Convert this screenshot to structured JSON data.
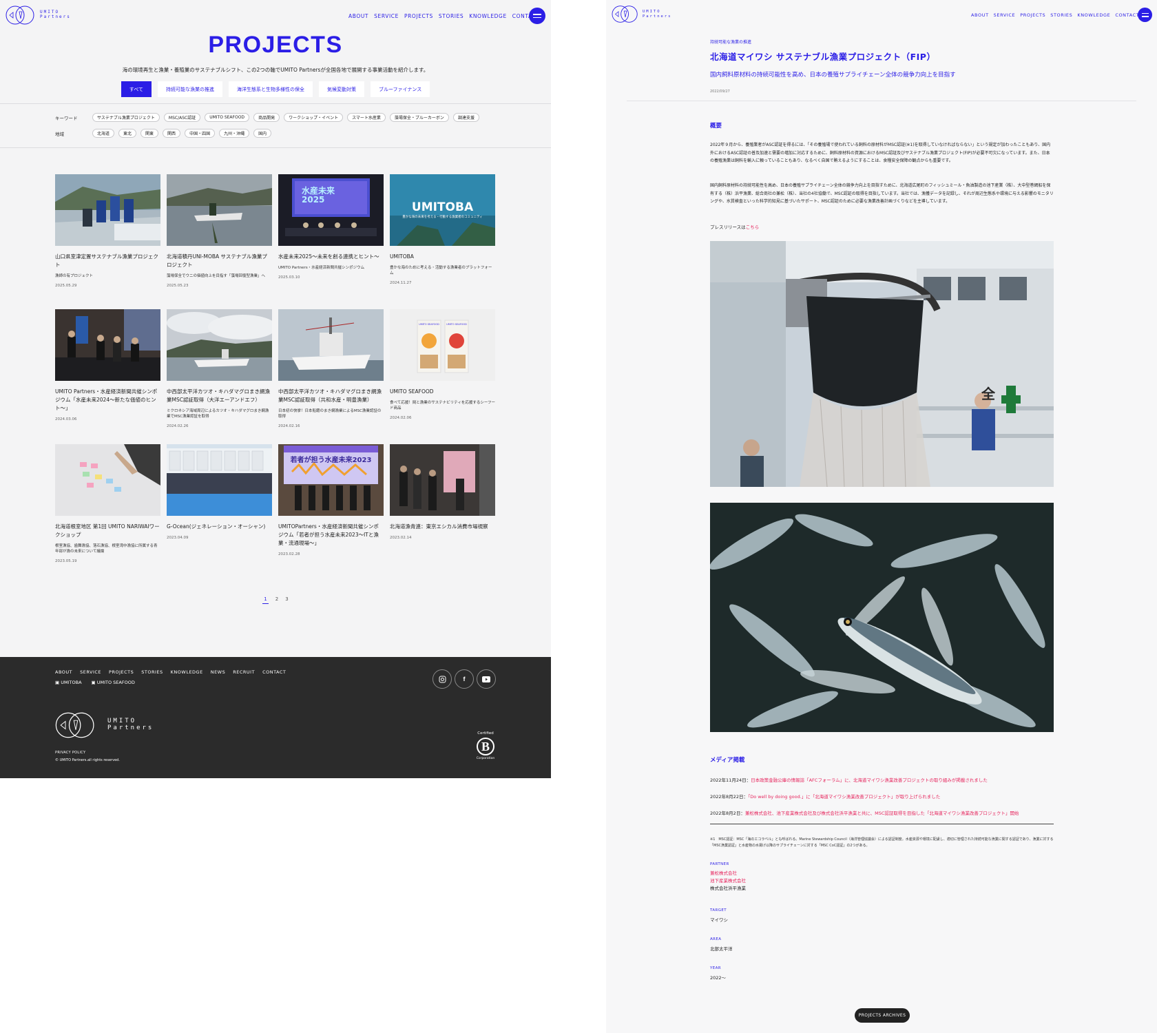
{
  "brand": {
    "name_line1": "UMITO",
    "name_line2": "Partners",
    "accent": "#2b1ee6",
    "link_color": "#e6245c"
  },
  "nav": {
    "items": [
      "ABOUT",
      "SERVICE",
      "PROJECTS",
      "STORIES",
      "KNOWLEDGE",
      "CONTACT"
    ],
    "menu_icon": "hamburger-icon"
  },
  "listing": {
    "title": "PROJECTS",
    "lead": "海の環境再生と漁業・養殖業のサステナブルシフト、この2つの軸でUMITO Partnersが全国各地で展開する事業活動を紹介します。",
    "tabs": [
      "すべて",
      "持続可能な漁業の推進",
      "海洋生態系と生物多様性の保全",
      "気候変動対策",
      "ブルーファイナンス"
    ],
    "filters": {
      "keyword_label": "キーワード",
      "keywords": [
        "サステナブル漁業プロジェクト",
        "MSC/ASC認証",
        "UMITO SEAFOOD",
        "商品開発",
        "ワークショップ・イベント",
        "スマート水産業",
        "藻場保全・ブルーカーボン",
        "調達支援"
      ],
      "region_label": "地域",
      "regions": [
        "北海道",
        "東北",
        "関東",
        "関西",
        "中国・四国",
        "九州・沖縄",
        "国内"
      ]
    },
    "cards": [
      {
        "title": "山口県室津定置サステナブル漁業プロジェクト",
        "sub": "漁師の有プロジェクト",
        "date": "2025.05.29"
      },
      {
        "title": "北海道積丹UNI-MOBA サステナブル漁業プロジェクト",
        "sub": "藻場保全でウニの価値向上を目指す「藻場回復型漁業」へ",
        "date": "2025.05.23"
      },
      {
        "title": "水産未来2025〜未来を創る連携とヒント〜",
        "sub": "UMITO Partners・水産経済新聞共催シンポジウム",
        "date": "2025.03.10"
      },
      {
        "title": "UMITOBA",
        "sub": "豊かな海のために考える・活動する漁業者のプラットフォーム",
        "date": "2024.11.27"
      },
      {
        "title": "UMITO Partners・水産経済新聞共催シンポジウム「水産未来2024〜新たな価値のヒント〜」",
        "sub": "",
        "date": "2024.03.06"
      },
      {
        "title": "中西部太平洋カツオ・キハダマグロまき網漁業MSC認証取得（大洋エーアンドエフ）",
        "sub": "ミクロネシア海域周辺によるカツオ・キハダマグロまき網漁業でMSC漁業認証を取得",
        "date": "2024.02.26"
      },
      {
        "title": "中西部太平洋カツオ・キハダマグロまき網漁業MSC認証取得（共和水産・明豊漁業）",
        "sub": "日本初の快挙！日本船籍のまき網漁業によるMSC漁業認証の取得",
        "date": "2024.02.16"
      },
      {
        "title": "UMITO SEAFOOD",
        "sub": "食べて応援！岡と漁業のサステナビリティを応援するシーフード商品",
        "date": "2024.02.06"
      },
      {
        "title": "北海道根室地区 第1回 UMITO NARIWAIワークショップ",
        "sub": "根室漁協、歯舞漁協、落石漁協、根室湾中漁協に所属する青年部が漁の未来について議論",
        "date": "2023.05.19"
      },
      {
        "title": "G-Ocean(ジェネレーション・オーシャン)",
        "sub": "",
        "date": "2023.04.09"
      },
      {
        "title": "UMITOPartners・水産経済新聞共催シンポジウム「若者が担う水産未来2023〜ITと漁業・流通現場〜」",
        "sub": "",
        "date": "2023.02.28"
      },
      {
        "title": "北海道漁青連：東京エシカル消費市場視察",
        "sub": "",
        "date": "2023.02.14"
      }
    ],
    "image_texts": {
      "card3_screen": "水産未来 2025",
      "card4_overlay": "UMITOBA",
      "card4_caption": "豊かな海の未来を考える・行動する漁業者のコミュニティ",
      "card7_banner": "若者が担う水産未来2023",
      "card8_label": "UMITO SEAFOOD"
    },
    "pager": [
      "1",
      "2",
      "3"
    ],
    "pager_current": "1"
  },
  "footer": {
    "nav": [
      "ABOUT",
      "SERVICE",
      "PROJECTS",
      "STORIES",
      "KNOWLEDGE",
      "NEWS",
      "RECRUIT",
      "CONTACT"
    ],
    "ext_links": [
      "UMITOBA",
      "UMITO SEAFOOD"
    ],
    "social": [
      "instagram-icon",
      "facebook-icon",
      "youtube-icon"
    ],
    "privacy": "PRIVACY POLICY",
    "copyright": "© UMITO Partners.all rights reserved.",
    "bcorp_top": "Certified",
    "bcorp_letter": "B",
    "bcorp_bottom": "Corporation"
  },
  "detail": {
    "category": "持続可能な漁業の推進",
    "title": "北海道マイワシ サステナブル漁業プロジェクト（FIP）",
    "subtitle": "国内飼料原材料の持続可能性を高め、日本の養殖サプライチェーン全体の競争力向上を目指す",
    "date": "2022/09/27",
    "overview_heading": "概要",
    "para1": "2022年９月から、養殖業者がASC認証を得るには、「その養殖場で使われている飼料の原材料がMSC認証(※1)を取得していなければならない」という規定が加わったこともあり、国内外におけるASC認証の普及加速と需要の増加に対応するために、飼料原材料の資源におけるMSC認証及びサステナブル漁業プロジェクト(FIP)が必要不可欠になっています。また、日本の養殖漁業は飼料を輸入に頼っていることもあり、なるべく自国で賄えるようにすることは、食糧安全保障の観点からも重要です。",
    "para2": "国内飼料原材料の持続可能性を高め、日本の養殖サプライチェーン全体の競争力向上を目指すために、北海道広尾町のフィッシュミール・魚油製造の池下産業（株）、大中型巻網船を保有する（株）浜平漁業、総合商社の兼松（株）、当社の4社協働で、MSC認証の取得を目指しています。当社では、漁獲データを記録し、それが周辺生態系や環境に与える影響のモニタリングや、水質検査といった科学的知見に基づいたサポート、MSC認証のために必要な漁業改善計画づくりなどを主導しています。",
    "press_prefix": "プレスリリースは",
    "press_link": "こちら",
    "media_heading": "メディア掲載",
    "media": [
      {
        "date": "2022年11月24日：",
        "text": "日本政策金融公庫の情報誌「AFCフォーラム」に、北海道マイワシ漁業改善プロジェクトの取り組みが掲載されました"
      },
      {
        "date": "2022年8月22日：",
        "text": "「Do well by doing good.」に「北海道マイワシ漁業改善プロジェクト」が取り上げられました"
      },
      {
        "date": "2022年8月2日：",
        "text": "兼松株式会社、池下産業株式会社及び株式会社浜平漁業と共に、MSC認証取得を目指した「北海道マイワシ漁業改善プロジェクト」開始"
      }
    ],
    "note": "※1　MSC認証：MSC「海のエコラベル」とも呼ばれる。Marine Stewardship Council（海洋管理協議会）による認証制度。水産資源や環境に配慮し、適切に管理された持続可能な漁業に関する認証であり、漁業に対する「MSC漁業認証」と水産物の水揚げ以降のサプライチェーンに対する「MSC CoC認証」の2つがある。",
    "partner_label": "PARTNER",
    "partners": [
      "兼松株式会社",
      "池下産業株式会社"
    ],
    "partner_plain": "株式会社浜平漁業",
    "target_label": "TARGET",
    "target": "マイワシ",
    "area_label": "AREA",
    "area": "北部太平洋",
    "year_label": "YEAR",
    "year": "2022〜",
    "archive_button": "PROJECTS ARCHIVES",
    "photo2_sign": "全"
  }
}
